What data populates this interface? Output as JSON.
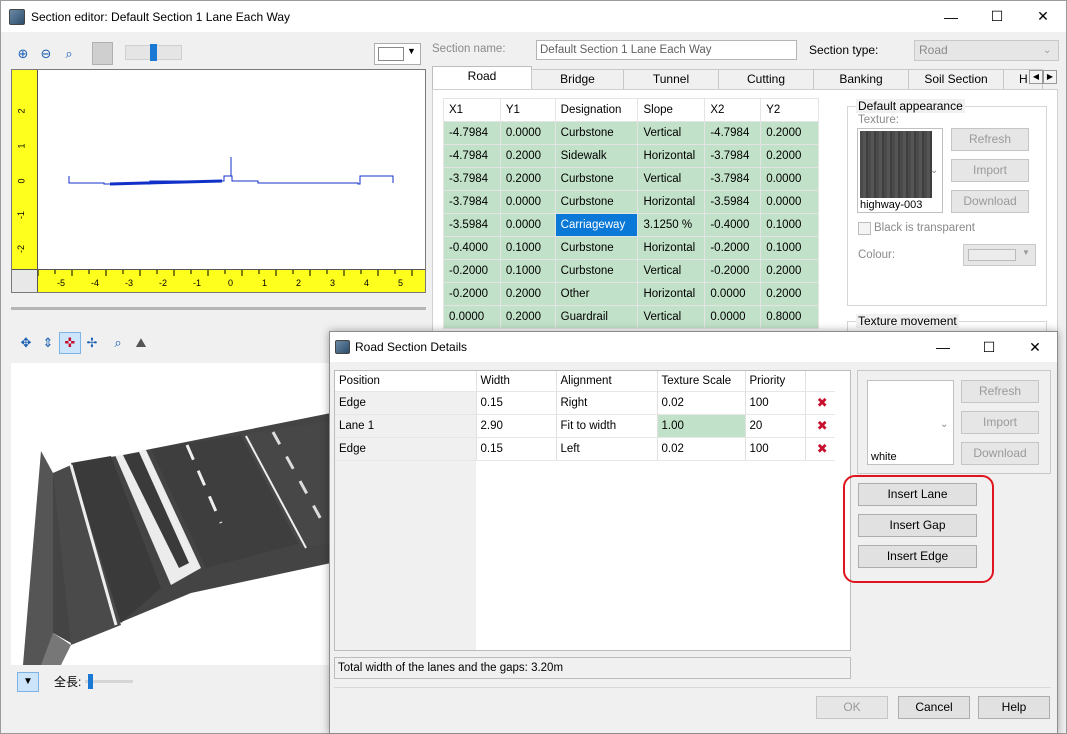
{
  "window": {
    "title": "Section editor: Default Section 1 Lane Each Way",
    "minimize_glyph": "—",
    "maximize_glyph": "☐",
    "close_glyph": "✕"
  },
  "profile_view": {
    "left_ruler_ticks": [
      "2",
      "1",
      "0",
      "-1",
      "-2"
    ],
    "bottom_ruler_ticks": [
      "-5",
      "-4",
      "-3",
      "-2",
      "-1",
      "0",
      "1",
      "2",
      "3",
      "4",
      "5"
    ]
  },
  "section": {
    "name_label": "Section name:",
    "name_value": "Default Section 1 Lane Each Way",
    "type_label": "Section type:",
    "type_value": "Road"
  },
  "tabs": [
    "Road",
    "Bridge",
    "Tunnel",
    "Cutting",
    "Banking",
    "Soil Section",
    "H"
  ],
  "coords_table": {
    "headers": [
      "X1",
      "Y1",
      "Designation",
      "Slope",
      "X2",
      "Y2"
    ],
    "rows": [
      [
        "-4.7984",
        "0.0000",
        "Curbstone",
        "Vertical",
        "-4.7984",
        "0.2000"
      ],
      [
        "-4.7984",
        "0.2000",
        "Sidewalk",
        "Horizontal",
        "-3.7984",
        "0.2000"
      ],
      [
        "-3.7984",
        "0.2000",
        "Curbstone",
        "Vertical",
        "-3.7984",
        "0.0000"
      ],
      [
        "-3.7984",
        "0.0000",
        "Curbstone",
        "Horizontal",
        "-3.5984",
        "0.0000"
      ],
      [
        "-3.5984",
        "0.0000",
        "Carriageway",
        "3.1250 %",
        "-0.4000",
        "0.1000"
      ],
      [
        "-0.4000",
        "0.1000",
        "Curbstone",
        "Horizontal",
        "-0.2000",
        "0.1000"
      ],
      [
        "-0.2000",
        "0.1000",
        "Curbstone",
        "Vertical",
        "-0.2000",
        "0.2000"
      ],
      [
        "-0.2000",
        "0.2000",
        "Other",
        "Horizontal",
        "0.0000",
        "0.2000"
      ],
      [
        "0.0000",
        "0.2000",
        "Guardrail",
        "Vertical",
        "0.0000",
        "0.8000"
      ]
    ]
  },
  "appearance": {
    "group_title": "Default appearance",
    "texture_label": "Texture:",
    "texture_name": "highway-003",
    "refresh": "Refresh",
    "import": "Import",
    "download": "Download",
    "black_transparent": "Black is transparent",
    "colour_label": "Colour:",
    "texture_movement_title": "Texture movement"
  },
  "preview_toolbar": {
    "length_label": "全長:"
  },
  "dialog": {
    "title": "Road Section Details",
    "headers": [
      "Position",
      "Width",
      "Alignment",
      "Texture Scale",
      "Priority"
    ],
    "rows": [
      [
        "Edge",
        "0.15",
        "Right",
        "0.02",
        "100"
      ],
      [
        "Lane 1",
        "2.90",
        "Fit to width",
        "1.00",
        "20"
      ],
      [
        "Edge",
        "0.15",
        "Left",
        "0.02",
        "100"
      ]
    ],
    "delete_glyph": "✖",
    "texture_name": "white",
    "refresh": "Refresh",
    "import": "Import",
    "download": "Download",
    "insert_lane": "Insert Lane",
    "insert_gap": "Insert Gap",
    "insert_edge": "Insert Edge",
    "status": "Total width of the lanes and the gaps: 3.20m",
    "ok": "OK",
    "cancel": "Cancel",
    "help": "Help",
    "highlight_color": "#e0141e"
  }
}
